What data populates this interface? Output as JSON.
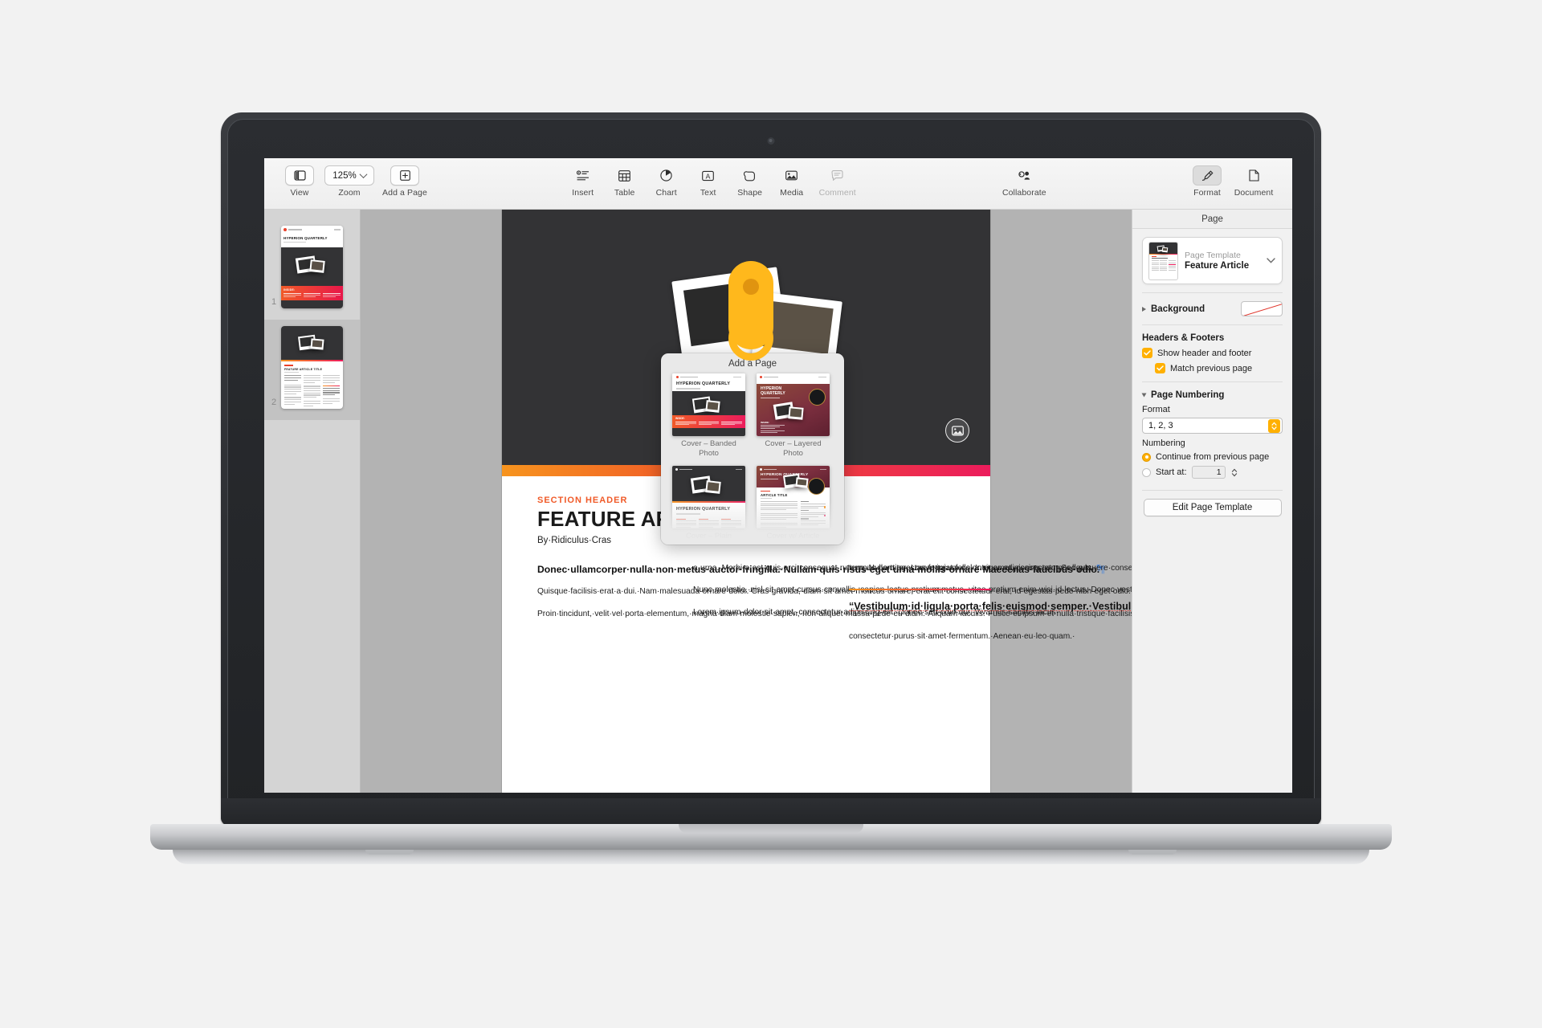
{
  "app": {
    "toolbar": {
      "view_label": "View",
      "zoom_label": "Zoom",
      "zoom_value": "125%",
      "add_page_label": "Add a Page",
      "insert_label": "Insert",
      "table_label": "Table",
      "chart_label": "Chart",
      "text_label": "Text",
      "shape_label": "Shape",
      "media_label": "Media",
      "comment_label": "Comment",
      "collaborate_label": "Collaborate",
      "format_label": "Format",
      "document_label": "Document"
    },
    "thumbnails": [
      {
        "number": "1",
        "selected": false
      },
      {
        "number": "2",
        "selected": true
      }
    ],
    "popover": {
      "title": "Add a Page",
      "templates": [
        {
          "caption": "Cover – Banded Photo",
          "style": "banded"
        },
        {
          "caption": "Cover – Layered Photo",
          "style": "layered"
        },
        {
          "caption": "Cover – Plain",
          "style": "plain"
        },
        {
          "caption": "Cover w/ Article",
          "style": "coverarticle"
        },
        {
          "caption": "",
          "style": "article-dark"
        },
        {
          "caption": "",
          "style": "article-maroon"
        }
      ]
    },
    "document": {
      "kicker": "SECTION HEADER",
      "headline": "FEATURE ARTICLE TITLE",
      "pilcrow": "¶",
      "byline": "By·Ridiculus·Cras",
      "columns": [
        {
          "lead": "Donec·ullamcorper·nulla·non·metus·auctor·fringilla.·Nullam·quis·risus·eget·urna·mollis·ornare·Maecenas·faucibus·odio.",
          "paragraphs": [
            "Quisque·facilisis·erat·a·dui.·Nam·malesuada·ornare·dolor.·Cras·gravida,·diam·sit·amet·rhoncus·ornare,·erat·elit·consectetuer·erat,·id·egestas·pede·nibh·eget·odio.·",
            "Proin·tincidunt,·velit·vel·porta·elementum,·magna·diam·molestie·sapien,·non·aliquet·massa·pede·eu·diam.·Aliquam·iaculis.·Fusce·et·ipsum·et·nulla·tristique·facilisis.·"
          ]
        },
        {
          "paragraphs": [
            "a·urna.·Morbi·a·est·quis·orci·consequat·rutrum.·Nullam·egestas·feugiat·felis.·Integer·adipiscing·semper·ligula.·",
            "Nunc·molestie,·nisl·sit·amet·cursus·convallis,·sapien·lectus·pretium·metus,·vitae·pretium·enim·wisi·id·lectus.·Donec·vestibulum.·Etiam·vel·nibh.·Nulla·facilisi.·Mauris·pharetra.·Donec·augue.·Fusce·ultrices,·neque·id·dignissim·ultrices,·tellus·mauris·dictum·elit,·vel·lacinia·enim·metus·eu·nunc.·",
            "Lorem·ipsum·dolor·sit·amet,·consectetur·adipiscing·elit.·Donec·sed·odio·dui.·Vivamus·sagittis·lacus·"
          ]
        },
        {
          "paragraphs": [
            "tempus·porttitor.·Lorem·ipsum·dolor·sit·amet,·consectetur·Sed·posuere·consectetur·est·at·lobortis.·Cum·sociis·natoque·penatibus·et·magnis·dis·parturient·montes,·nascetur·ridiculus·mus.·Cras·mattis·"
          ],
          "pullquote": "“Vestibulum·id·ligula·porta·felis·euismod·semper.·Vestibulum·id·ligula·porta·felis·euismod·semper.”",
          "after_pullquote": "consectetur·purus·sit·amet·fermentum.·Aenean·eu·leo·quam.·"
        }
      ]
    },
    "inspector": {
      "header": "Page",
      "template_kicker": "Page Template",
      "template_name": "Feature Article",
      "background_label": "Background",
      "headers_footers_label": "Headers & Footers",
      "show_header_footer_label": "Show header and footer",
      "show_header_footer_checked": true,
      "match_previous_label": "Match previous page",
      "match_previous_checked": true,
      "page_numbering_label": "Page Numbering",
      "format_label": "Format",
      "format_value": "1, 2, 3",
      "numbering_label": "Numbering",
      "continue_label": "Continue from previous page",
      "continue_selected": true,
      "start_at_label": "Start at:",
      "start_at_value": "1",
      "start_at_selected": false,
      "edit_template_button": "Edit Page Template"
    }
  },
  "hardware": {
    "brand": ""
  },
  "colors": {
    "accent_orange": "#f7941e",
    "accent_pink": "#ec1c5c",
    "accent_red": "#e8412a",
    "annotation": "#ffb81c",
    "control_yellow": "#ffb000"
  }
}
